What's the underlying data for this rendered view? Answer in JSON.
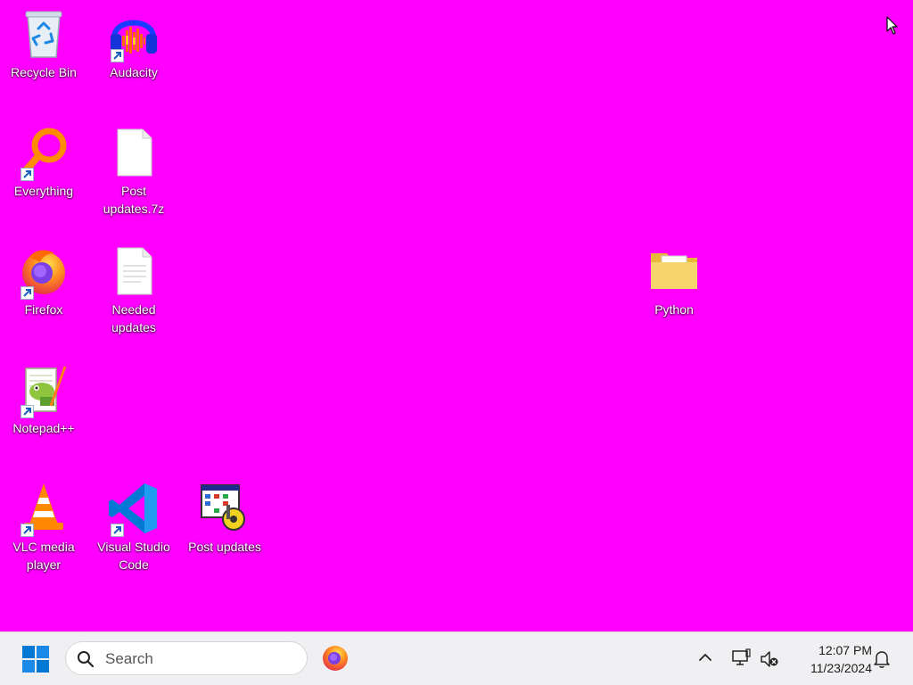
{
  "desktop": {
    "background": "#ff00ff",
    "icons": [
      {
        "id": "recycle-bin",
        "label": "Recycle Bin",
        "icon": "recycle-bin-icon",
        "shortcut": false
      },
      {
        "id": "audacity",
        "label": "Audacity",
        "icon": "audacity-icon",
        "shortcut": true
      },
      {
        "id": "everything",
        "label": "Everything",
        "icon": "everything-search-icon",
        "shortcut": true
      },
      {
        "id": "post-updates-7z",
        "label": "Post updates.7z",
        "icon": "blank-file-icon",
        "shortcut": false
      },
      {
        "id": "firefox",
        "label": "Firefox",
        "icon": "firefox-icon",
        "shortcut": true
      },
      {
        "id": "needed-updates",
        "label": "Needed updates",
        "icon": "text-file-icon",
        "shortcut": false
      },
      {
        "id": "python",
        "label": "Python",
        "icon": "folder-icon",
        "shortcut": false
      },
      {
        "id": "notepad-plus-plus",
        "label": "Notepad++",
        "icon": "notepad-plus-plus-icon",
        "shortcut": true
      },
      {
        "id": "vlc",
        "label": "VLC media player",
        "icon": "vlc-cone-icon",
        "shortcut": true
      },
      {
        "id": "vscode",
        "label": "Visual Studio Code",
        "icon": "vscode-icon",
        "shortcut": true
      },
      {
        "id": "post-updates",
        "label": "Post updates",
        "icon": "app-settings-icon",
        "shortcut": false
      }
    ]
  },
  "taskbar": {
    "start_icon": "windows-logo-icon",
    "search": {
      "placeholder": "Search"
    },
    "pinned": [
      {
        "name": "Firefox",
        "icon": "firefox-icon"
      }
    ],
    "tray": {
      "overflow_icon": "chevron-up-icon",
      "network_icon": "network-icon",
      "volume_icon": "volume-muted-icon",
      "notification_icon": "bell-icon"
    },
    "clock": {
      "time": "12:07 PM",
      "date": "11/23/2024"
    }
  }
}
